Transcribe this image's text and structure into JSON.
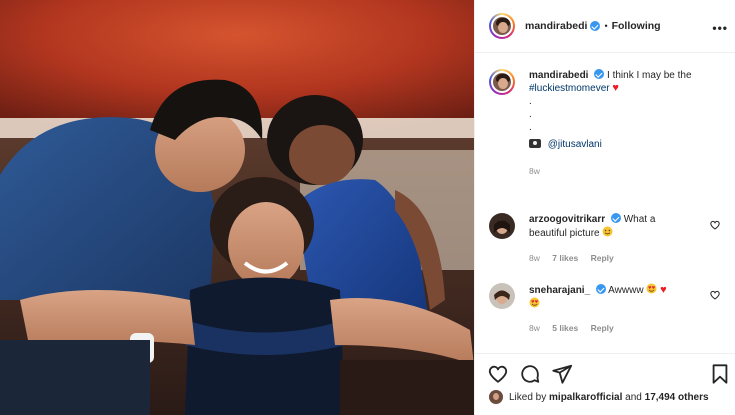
{
  "post": {
    "username": "mandirabedi",
    "follow_separator": "•",
    "follow_status": "Following",
    "more_icon": "more-options-icon"
  },
  "caption": {
    "username": "mandirabedi",
    "text": "I think I may be the",
    "hashtag": "#luckiestmomever",
    "dots": [
      ".",
      ".",
      "."
    ],
    "credit_mention": "@jitusavlani",
    "age": "8w"
  },
  "comments": [
    {
      "username": "arzoogovitrikarr",
      "text_line1": "What a",
      "text_line2": "beautiful picture",
      "age": "8w",
      "likes": "7 likes",
      "reply": "Reply"
    },
    {
      "username": "sneharajani_",
      "text": "Awwww",
      "age": "8w",
      "likes": "5 likes",
      "reply": "Reply"
    }
  ],
  "liked_by": {
    "prefix": "Liked by",
    "user": "mipalkarofficial",
    "joiner": "and",
    "others": "17,494 others"
  },
  "icons": {
    "like": "heart-outline-icon",
    "comment": "comment-bubble-icon",
    "share": "paper-plane-icon",
    "save": "bookmark-icon"
  },
  "colors": {
    "verified": "#3897f0",
    "link": "#00376b",
    "heart_red": "#ed1c24",
    "muted": "#8e8e8e"
  }
}
